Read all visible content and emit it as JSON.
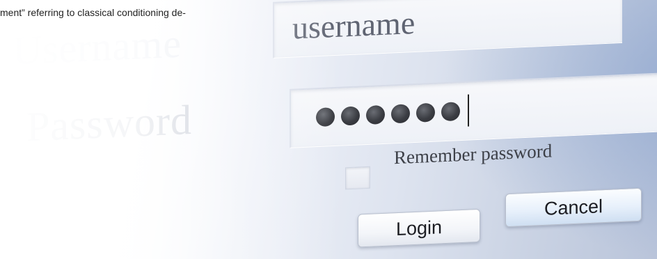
{
  "caption": "ment” referring to classical conditioning de-",
  "form": {
    "username_label": "Username",
    "username_value": "username",
    "password_label": "Password",
    "password_mask_count": 6,
    "remember_label": "Remember password",
    "remember_checked": false,
    "login_label": "Login",
    "cancel_label": "Cancel"
  },
  "icons": {
    "password_dot": "filled-circle-icon",
    "text_caret": "text-cursor-icon"
  },
  "colors": {
    "label_faded": "#c9cedb",
    "field_text": "#5f6472",
    "dot": "#3a3c42",
    "cancel_tint": "#cfdff2"
  }
}
